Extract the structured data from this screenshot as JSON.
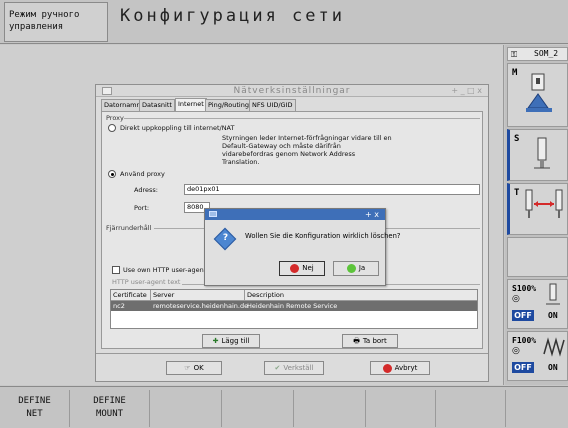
{
  "header": {
    "mode_line1": "Режим ручного",
    "mode_line2": "управления",
    "screen_title": "Конфигурация сети"
  },
  "right_panel": {
    "tab_label": "SOM_2",
    "tile_m": "M",
    "tile_s": "S",
    "tile_t": "T",
    "spindle_override": "S100%",
    "feed_override": "F100%",
    "off_label": "OFF",
    "on_label": "ON"
  },
  "dialog": {
    "title": "Nätverksinställningar",
    "window_buttons": "+ _ □ x",
    "tabs": [
      "Datornamn",
      "Datasnitt",
      "Internet",
      "Ping/Routing",
      "NFS UID/GID"
    ],
    "active_tab": "Internet",
    "proxy_group": "Proxy",
    "direct_option": "Direkt uppkoppling till internet/NAT",
    "direct_note": [
      "Styrningen leder Internet-förfrågningar vidare till en",
      "Default-Gateway och måste därifrån",
      "vidarebefordras genom Network Address",
      "Translation."
    ],
    "use_proxy_option": "Använd proxy",
    "address_label": "Adress:",
    "address_value": "de01px01",
    "port_label": "Port:",
    "port_value": "8080",
    "remote_group": "Fjärrunderhåll",
    "use_own_agent": "Use own HTTP user-agent",
    "agent_text_label": "HTTP user-agent text",
    "table": {
      "headers": [
        "Certificate",
        "Server",
        "Description"
      ],
      "rows": [
        [
          "nc2",
          "remoteservice.heidenhain.de",
          "Heidenhain Remote Service"
        ]
      ]
    },
    "add_button": "Lägg till",
    "remove_button": "Ta bort",
    "ok_button": "OK",
    "apply_button": "Verkställ",
    "cancel_button": "Avbryt"
  },
  "confirm": {
    "window_buttons": "+ x",
    "message": "Wollen Sie die Konfiguration wirklich löschen?",
    "no_button": "Nej",
    "yes_button": "Ja"
  },
  "softkeys": [
    {
      "line1": "DEFINE",
      "line2": "NET"
    },
    {
      "line1": "DEFINE",
      "line2": "MOUNT"
    }
  ],
  "colors": {
    "accent_blue": "#3e6fb8",
    "off_badge": "#1e4aa0",
    "selected_row": "#6e6e6e",
    "no_icon": "#d42a2a",
    "yes_icon": "#5cc43a"
  }
}
